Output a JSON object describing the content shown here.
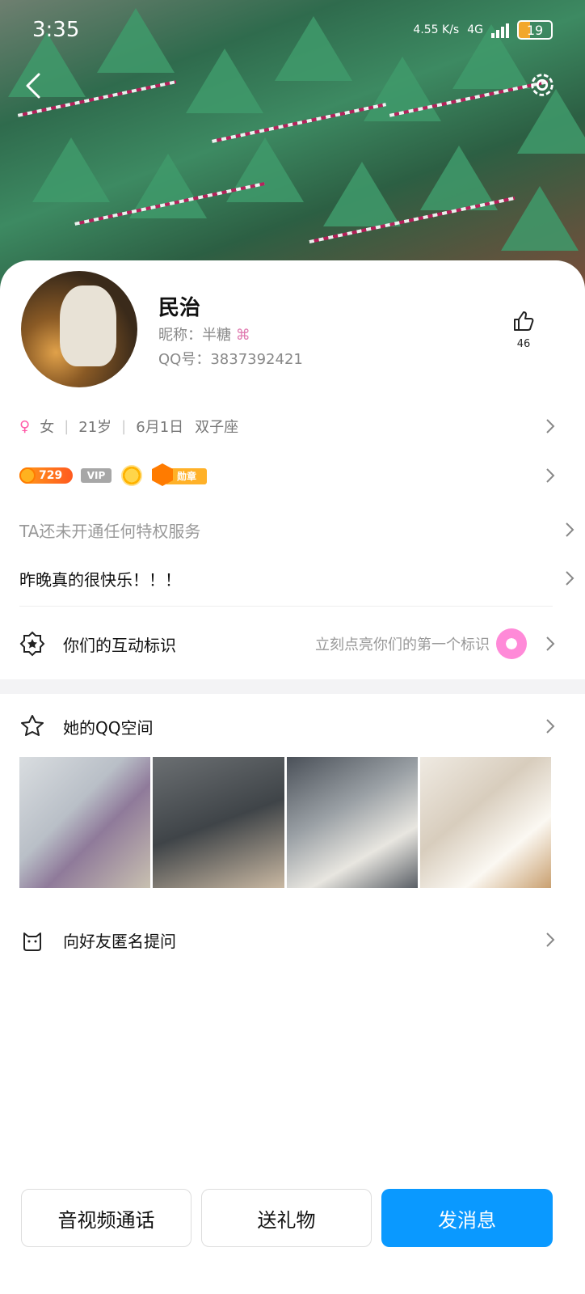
{
  "status_bar": {
    "time": "3:35",
    "net_speed": "4.55 K/s",
    "network": "4G",
    "battery": "19"
  },
  "profile": {
    "name": "民治",
    "nickname": "昵称：半糖",
    "qq_number": "QQ号：3837392421",
    "likes": "46",
    "gender_symbol": "♀",
    "gender": "女",
    "age": "21岁",
    "birthday": "6月1日",
    "zodiac": "双子座",
    "coin_level": "729",
    "vip_label": "VIP",
    "medal_label": "勋章",
    "privilege_text": "TA还未开通任何特权服务",
    "signature": "昨晚真的很快乐！！！"
  },
  "interaction": {
    "title": "你们的互动标识",
    "hint": "立刻点亮你们的第一个标识"
  },
  "qzone": {
    "title": "她的QQ空间"
  },
  "ask": {
    "title": "向好友匿名提问"
  },
  "actions": {
    "call": "音视频通话",
    "gift": "送礼物",
    "message": "发消息"
  },
  "colors": {
    "accent": "#0a99ff",
    "gender_pink": "#ff5aa8",
    "coin_orange": "#ff7b00"
  }
}
